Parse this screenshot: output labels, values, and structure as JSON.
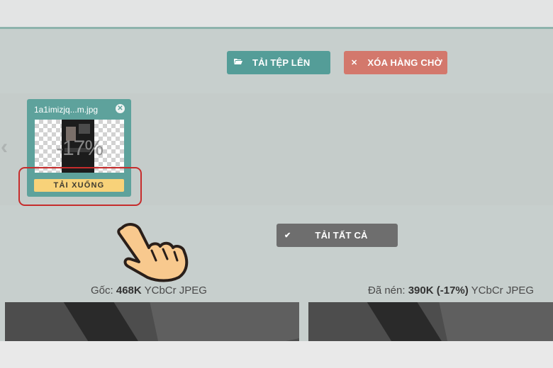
{
  "toolbar": {
    "upload_label": "TẢI TỆP LÊN",
    "upload_icon": "folder-open-icon",
    "clear_label": "XÓA HÀNG CHỜ",
    "clear_icon": "close-icon",
    "download_all_label": "TẢI TẤT CẢ",
    "download_all_icon": "check-icon"
  },
  "queue": {
    "items": [
      {
        "filename": "1a1imizjq...m.jpg",
        "compression_label": "-17%",
        "download_label": "TẢI XUỐNG"
      }
    ],
    "nav_icon": "chevron-left-icon"
  },
  "comparison": {
    "original": {
      "prefix": "Gốc:",
      "size": "468K",
      "format": "YCbCr JPEG"
    },
    "compressed": {
      "prefix": "Đã nén:",
      "size": "390K (-17%)",
      "format": "YCbCr JPEG"
    }
  },
  "colors": {
    "upload_button": "#549d98",
    "clear_button": "#d3786c",
    "download_all_button": "#6e6e6e",
    "download_button": "#f8d279",
    "highlight": "#c62c2c"
  }
}
